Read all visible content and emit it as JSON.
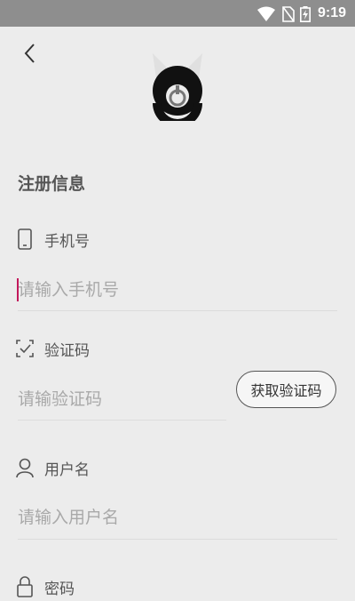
{
  "status_bar": {
    "time": "9:19",
    "icons": [
      "wifi-icon",
      "no-sim-icon",
      "battery-charging-icon"
    ]
  },
  "header": {
    "back_icon": "chevron-left-icon"
  },
  "form": {
    "section_title": "注册信息",
    "phone": {
      "label": "手机号",
      "placeholder": "请输入手机号",
      "icon": "phone-icon"
    },
    "code": {
      "label": "验证码",
      "placeholder": "请输验证码",
      "icon": "scan-check-icon",
      "button": "获取验证码"
    },
    "username": {
      "label": "用户名",
      "placeholder": "请输入用户名",
      "icon": "user-icon"
    },
    "password": {
      "label": "密码",
      "icon": "lock-icon"
    }
  },
  "colors": {
    "status_bar": "#8e8e8e",
    "background": "#ececec",
    "caret": "#c2185b"
  }
}
